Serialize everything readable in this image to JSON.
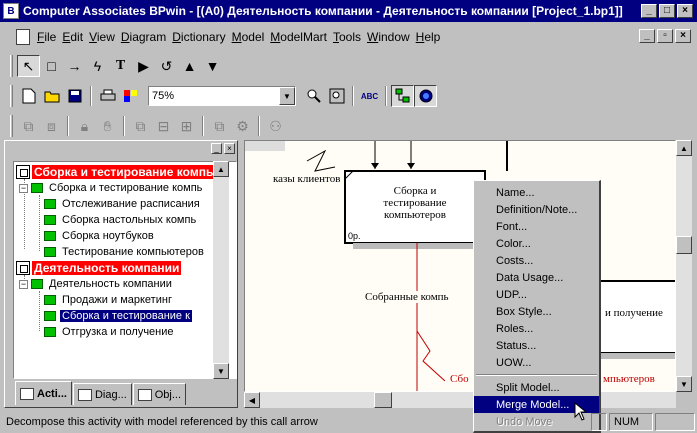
{
  "window": {
    "title": "Computer Associates BPwin - [(A0) Деятельность компании - Деятельность компании  [Project_1.bp1]]",
    "controls": [
      "minimize",
      "maximize",
      "close"
    ]
  },
  "menu": {
    "items": [
      "File",
      "Edit",
      "View",
      "Diagram",
      "Dictionary",
      "Model",
      "ModelMart",
      "Tools",
      "Window",
      "Help"
    ]
  },
  "toolbar_draw": {
    "tools": [
      "pointer-tool-icon",
      "box-tool-icon",
      "arrow-tool-icon",
      "squiggle-tool-icon",
      "text-tool-icon",
      "decompose-tool-icon",
      "undo-rotate-icon",
      "go-up-icon",
      "go-down-icon"
    ],
    "glyphs": [
      "↖",
      "□",
      "→",
      "ϟ",
      "T",
      "▶",
      "↺",
      "▲",
      "▼"
    ]
  },
  "toolbar_std": {
    "zoom_value": "75%"
  },
  "browser": {
    "tree": [
      {
        "label": "Сборка и тестирование компь",
        "kind": "root"
      },
      {
        "label": "Сборка и тестирование компь",
        "kind": "parent"
      },
      {
        "label": "Отслеживание расписания",
        "kind": "leaf"
      },
      {
        "label": "Сборка настольных компь",
        "kind": "leaf"
      },
      {
        "label": "Сборка ноутбуков",
        "kind": "leaf"
      },
      {
        "label": "Тестирование компьютеров",
        "kind": "leaf"
      },
      {
        "label": "Деятельность компании",
        "kind": "root"
      },
      {
        "label": "Деятельность компании",
        "kind": "parent"
      },
      {
        "label": "Продажи и маркетинг",
        "kind": "leaf"
      },
      {
        "label": "Сборка и тестирование к",
        "kind": "leaf-selected"
      },
      {
        "label": "Отгрузка и получение",
        "kind": "leaf"
      }
    ],
    "tabs": [
      "Acti...",
      "Diag...",
      "Obj..."
    ]
  },
  "canvas": {
    "box1_label": "Сборка и тестирование компьютеров",
    "box1_node": "0р.",
    "arrow_label_1": "казы клиентов",
    "arrow_label_2": "Собранные компь",
    "arrow_label_3": "Сбо",
    "arrow_label_4": "мпьютеров",
    "box2_label": "и получение"
  },
  "context_menu": {
    "items": [
      "Name...",
      "Definition/Note...",
      "Font...",
      "Color...",
      "Costs...",
      "Data Usage...",
      "UDP...",
      "Box Style...",
      "Roles...",
      "Status...",
      "UOW..."
    ],
    "items2": [
      "Split Model...",
      "Merge Model...",
      "Undo Move"
    ]
  },
  "statusbar": {
    "text": "Decompose this activity with model referenced by this call arrow",
    "num": "NUM"
  },
  "colors": {
    "title_bg": "#000080",
    "selection": "#000080",
    "root_highlight": "#ff0000",
    "activity_icon": "#00c000",
    "arrow_red": "#c00000"
  }
}
